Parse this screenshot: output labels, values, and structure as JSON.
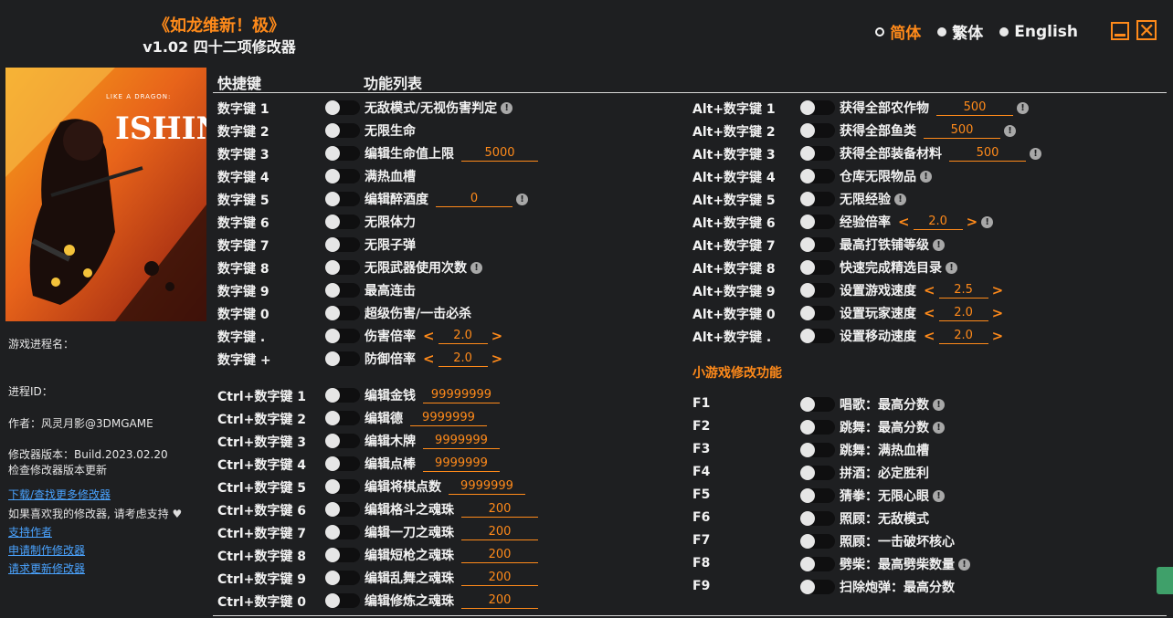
{
  "header": {
    "title": "《如龙维新！极》",
    "subtitle": "v1.02 四十二项修改器"
  },
  "languages": [
    {
      "label": "简体",
      "active": true
    },
    {
      "label": "繁体",
      "active": false
    },
    {
      "label": "English",
      "active": false
    }
  ],
  "window": {
    "close_glyph": "✕"
  },
  "columns": {
    "hotkey": "快捷键",
    "functions": "功能列表"
  },
  "sidebar": {
    "process_name_label": "游戏进程名：",
    "process_id_label": "进程ID：",
    "author": "作者：风灵月影@3DMGAME",
    "version": "修改器版本：Build.2023.02.20",
    "check_update": "检查修改器版本更新",
    "download_more": "下载/查找更多修改器",
    "support_text": "如果喜欢我的修改器, 请考虑支持",
    "heart": "♥",
    "support_author": "支持作者",
    "request_trainer": "申请制作修改器",
    "request_update": "请求更新修改器"
  },
  "left_block1": [
    {
      "key": "数字键 1",
      "name": "无敌模式/无视伤害判定",
      "info": true
    },
    {
      "key": "数字键 2",
      "name": "无限生命"
    },
    {
      "key": "数字键 3",
      "name": "编辑生命值上限",
      "value": "5000",
      "vw": 84
    },
    {
      "key": "数字键 4",
      "name": "满热血槽"
    },
    {
      "key": "数字键 5",
      "name": "编辑醉酒度",
      "value": "0",
      "vw": 84,
      "info": true
    },
    {
      "key": "数字键 6",
      "name": "无限体力"
    },
    {
      "key": "数字键 7",
      "name": "无限子弹"
    },
    {
      "key": "数字键 8",
      "name": "无限武器使用次数",
      "info": true
    },
    {
      "key": "数字键 9",
      "name": "最高连击"
    },
    {
      "key": "数字键 0",
      "name": "超级伤害/一击必杀"
    },
    {
      "key": "数字键 .",
      "name": "伤害倍率",
      "stepper": "2.0"
    },
    {
      "key": "数字键 +",
      "name": "防御倍率",
      "stepper": "2.0"
    }
  ],
  "left_block2": [
    {
      "key": "Ctrl+数字键 1",
      "name": "编辑金钱",
      "value": "99999999",
      "vw": 84
    },
    {
      "key": "Ctrl+数字键 2",
      "name": "编辑德",
      "value": "9999999",
      "vw": 84
    },
    {
      "key": "Ctrl+数字键 3",
      "name": "编辑木牌",
      "value": "9999999",
      "vw": 84
    },
    {
      "key": "Ctrl+数字键 4",
      "name": "编辑点棒",
      "value": "9999999",
      "vw": 84
    },
    {
      "key": "Ctrl+数字键 5",
      "name": "编辑将棋点数",
      "value": "9999999",
      "vw": 84
    },
    {
      "key": "Ctrl+数字键 6",
      "name": "编辑格斗之魂珠",
      "value": "200",
      "vw": 84
    },
    {
      "key": "Ctrl+数字键 7",
      "name": "编辑一刀之魂珠",
      "value": "200",
      "vw": 84
    },
    {
      "key": "Ctrl+数字键 8",
      "name": "编辑短枪之魂珠",
      "value": "200",
      "vw": 84
    },
    {
      "key": "Ctrl+数字键 9",
      "name": "编辑乱舞之魂珠",
      "value": "200",
      "vw": 84
    },
    {
      "key": "Ctrl+数字键 0",
      "name": "编辑修炼之魂珠",
      "value": "200",
      "vw": 84
    }
  ],
  "right_block1": [
    {
      "key": "Alt+数字键 1",
      "name": "获得全部农作物",
      "value": "500",
      "vw": 84,
      "info": true
    },
    {
      "key": "Alt+数字键 2",
      "name": "获得全部鱼类",
      "value": "500",
      "vw": 84,
      "info": true
    },
    {
      "key": "Alt+数字键 3",
      "name": "获得全部装备材料",
      "value": "500",
      "vw": 84,
      "info": true
    },
    {
      "key": "Alt+数字键 4",
      "name": "仓库无限物品",
      "info": true
    },
    {
      "key": "Alt+数字键 5",
      "name": "无限经验",
      "info": true
    },
    {
      "key": "Alt+数字键 6",
      "name": "经验倍率",
      "stepper": "2.0",
      "info": true
    },
    {
      "key": "Alt+数字键 7",
      "name": "最高打铁铺等级",
      "info": true
    },
    {
      "key": "Alt+数字键 8",
      "name": "快速完成精选目录",
      "info": true
    },
    {
      "key": "Alt+数字键 9",
      "name": "设置游戏速度",
      "stepper": "2.5"
    },
    {
      "key": "Alt+数字键 0",
      "name": "设置玩家速度",
      "stepper": "2.0"
    },
    {
      "key": "Alt+数字键 .",
      "name": "设置移动速度",
      "stepper": "2.0"
    }
  ],
  "minigame_title": "小游戏修改功能",
  "right_block2": [
    {
      "key": "F1",
      "name": "唱歌：最高分数",
      "info": true
    },
    {
      "key": "F2",
      "name": "跳舞：最高分数",
      "info": true
    },
    {
      "key": "F3",
      "name": "跳舞：满热血槽"
    },
    {
      "key": "F4",
      "name": "拼酒：必定胜利"
    },
    {
      "key": "F5",
      "name": "猜拳：无限心眼",
      "info": true
    },
    {
      "key": "F6",
      "name": "照顾：无敌模式"
    },
    {
      "key": "F7",
      "name": "照顾：一击破坏核心"
    },
    {
      "key": "F8",
      "name": "劈柴：最高劈柴数量",
      "info": true
    },
    {
      "key": "F9",
      "name": "扫除炮弹：最高分数"
    }
  ],
  "colors": {
    "accent": "#ff8a1a",
    "link": "#4aa3ff",
    "bg": "#1e1f21"
  }
}
